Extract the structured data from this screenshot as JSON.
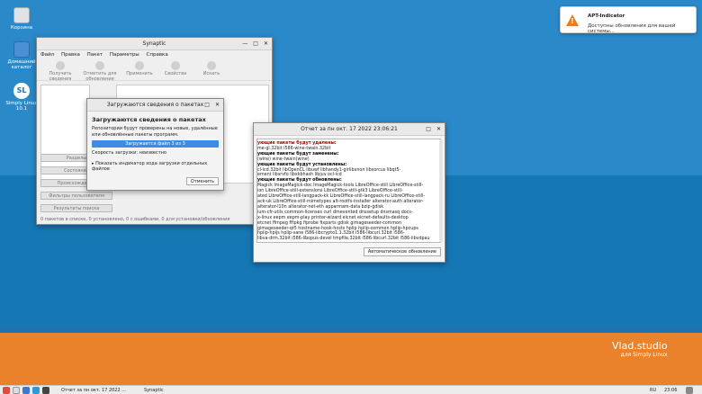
{
  "desktop": {
    "icons": [
      {
        "label": "Корзина"
      },
      {
        "label": "Домашний каталог"
      },
      {
        "label": "Simply Linux 10.1",
        "glyph": "SL"
      }
    ],
    "watermark": {
      "title": "Vlad.studio",
      "subtitle": "для Simply Linux"
    }
  },
  "notification": {
    "title": "APT-Indicator",
    "body": "Доступны обновления для вашей системы...",
    "glyph": "!"
  },
  "synaptic": {
    "title": "Synaptic",
    "menu": [
      "Файл",
      "Правка",
      "Пакет",
      "Параметры",
      "Справка"
    ],
    "toolbar": [
      "Получить сведения",
      "Отметить для обновления",
      "Применить",
      "Свойства",
      "Искать"
    ],
    "left_buttons": [
      "Разделы",
      "Состояние",
      "Происхождение",
      "Фильтры пользователя",
      "Результаты поиска"
    ],
    "status": "0 пакетов в списке, 0 установлено, 0 с ошибками, 0 для установки/обновления"
  },
  "loading_dialog": {
    "title": "Загружаются сведения о пакетах",
    "heading": "Загружаются сведения о пакетах",
    "desc": "Репозитории будут проверены на новые, удалённые или обновлённые пакеты программ.",
    "progress": "Загружается файл 3 из 3",
    "speed": "Скорость загрузки: неизвестно",
    "show_details": "Показать индикатор хода загрузки отдельных файлов",
    "cancel": "Отменить"
  },
  "report": {
    "title": "Отчет за пн окт. 17 2022 23:06:21",
    "lines": [
      {
        "t": "ующие пакеты будут удалены:",
        "c": "red"
      },
      {
        "t": "me-gl.32bit i586-wine-twain.32bit",
        "c": ""
      },
      {
        "t": "ующие пакеты будут заменены:",
        "c": "bl"
      },
      {
        "t": "(wine) wine-twain(wine)",
        "c": ""
      },
      {
        "t": "ующие пакеты будут установлены:",
        "c": "bl"
      },
      {
        "t": "cl-icd.32bit libOpenCL libuwf libhandy1-girlibxnon libxorcus libqt5-",
        "c": ""
      },
      {
        "t": "ement libsrvfo libxkbhash libjuv ocl-icd",
        "c": ""
      },
      {
        "t": "ующие пакеты будут обновлены:",
        "c": "bl"
      },
      {
        "t": "Magick ImageMagick-doc ImageMagick-tools LibreOffice-still LibreOffice-still-",
        "c": ""
      },
      {
        "t": "ion LibreOffice-still-extensions LibreOffice-still-gtk3 LibreOffice-still-",
        "c": ""
      },
      {
        "t": "ated LibreOffice-still-langpack-kk LibreOffice-still-langpack-ru LibreOffice-still-",
        "c": ""
      },
      {
        "t": "ack-uk LibreOffice-still-mimetypes alt-rootfs-installer alterator-auth alterator-",
        "c": ""
      },
      {
        "t": "alterator-l10n alterator-net-eth apparmam-data bzip-gdisk",
        "c": ""
      },
      {
        "t": "ium-cfr-utils common-licenses curl dmevented dnssetup dnsmasq docs-",
        "c": ""
      },
      {
        "t": "x-linux eepm eepm-play printer-wizard eicnet eicnet-defaults-desktop",
        "c": ""
      },
      {
        "t": "etcnet ffmpeg fftpkg fiprobe fixparts gdisk gimageseeder-common",
        "c": ""
      },
      {
        "t": "gimageseeder-qt5 hostname-hook-hosts hplip hplip-common hplip-hpcups",
        "c": ""
      },
      {
        "t": "hplip-hpijs hplip-sane i586-libcrypto1.1.32bit i586-libcurl.32bit i586-",
        "c": ""
      },
      {
        "t": "libva-drm.32bit i586-libopus-devel tmpfile.32bit i586-libcurl.32bit i586-libvdpau",
        "c": ""
      }
    ],
    "auto_update": "Автоматическое обновление"
  },
  "taskbar": {
    "tasks": [
      "Отчет за пн окт. 17 2022 ...",
      "Synaptic"
    ],
    "lang": "RU",
    "time": "23:06"
  }
}
